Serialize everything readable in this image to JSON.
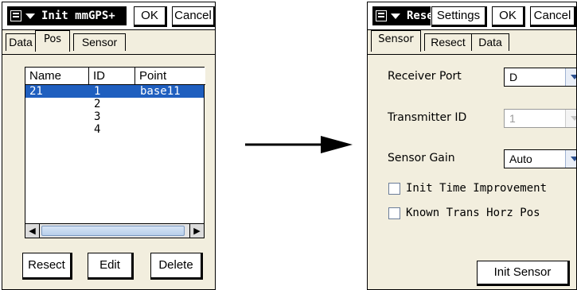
{
  "left_screen": {
    "title": "Init mmGPS+",
    "ok_label": "OK",
    "cancel_label": "Cancel",
    "tabs": [
      {
        "label": "Data",
        "active": false
      },
      {
        "label": "Pos",
        "active": true
      },
      {
        "label": "Sensor",
        "active": false
      }
    ],
    "table": {
      "columns": [
        "Name",
        "ID",
        "Point"
      ],
      "rows": [
        {
          "name": "21",
          "id": "1",
          "point": "base11",
          "selected": true
        },
        {
          "name": "",
          "id": "2",
          "point": "",
          "selected": false
        },
        {
          "name": "",
          "id": "3",
          "point": "",
          "selected": false
        },
        {
          "name": "",
          "id": "4",
          "point": "",
          "selected": false
        }
      ]
    },
    "buttons": {
      "resect": "Resect",
      "edit": "Edit",
      "delete": "Delete"
    }
  },
  "right_screen": {
    "title": "Rese",
    "settings_label": "Settings",
    "ok_label": "OK",
    "cancel_label": "Cancel",
    "tabs": [
      {
        "label": "Sensor",
        "active": true
      },
      {
        "label": "Resect",
        "active": false
      },
      {
        "label": "Data",
        "active": false
      }
    ],
    "fields": {
      "receiver_port": {
        "label": "Receiver Port",
        "value": "D"
      },
      "transmitter_id": {
        "label": "Transmitter ID",
        "value": "1",
        "disabled": true
      },
      "sensor_gain": {
        "label": "Sensor Gain",
        "value": "Auto"
      }
    },
    "checkboxes": {
      "init_time_improvement": {
        "label": "Init Time Improvement",
        "checked": false
      },
      "known_trans_horz_pos": {
        "label": "Known Trans Horz Pos",
        "checked": false
      }
    },
    "init_sensor_label": "Init Sensor"
  },
  "colors": {
    "selection": "#1f5fbf",
    "panel_bg": "#f2eede",
    "titlebar": "#000000"
  },
  "icons": {
    "start_menu": "windows-start-icon",
    "transition_arrow": "right-arrow-icon"
  }
}
